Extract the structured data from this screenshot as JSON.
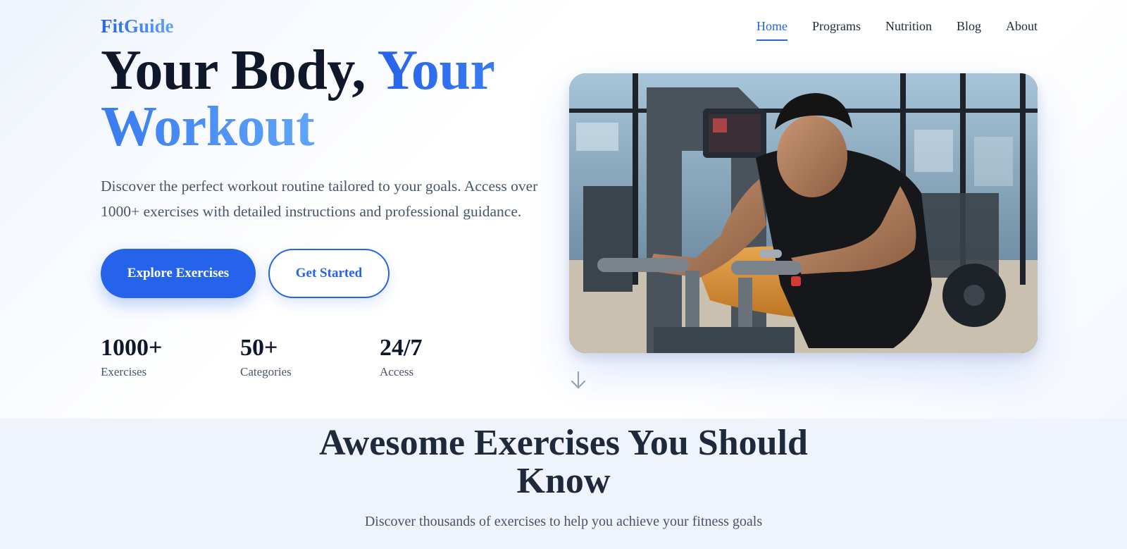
{
  "brand": {
    "name": "FitGuide"
  },
  "nav": {
    "items": [
      {
        "label": "Home",
        "active": true
      },
      {
        "label": "Programs",
        "active": false
      },
      {
        "label": "Nutrition",
        "active": false
      },
      {
        "label": "Blog",
        "active": false
      },
      {
        "label": "About",
        "active": false
      }
    ]
  },
  "hero": {
    "headline_part1": "Your Body, ",
    "headline_part2": "Your Workout",
    "description": "Discover the perfect workout routine tailored to your goals. Access over 1000+ exercises with detailed instructions and professional guidance.",
    "primary_button": "Explore Exercises",
    "secondary_button": "Get Started",
    "stats": [
      {
        "value": "1000+",
        "label": "Exercises"
      },
      {
        "value": "50+",
        "label": "Categories"
      },
      {
        "value": "24/7",
        "label": "Access"
      }
    ],
    "scroll_icon": "arrow-down-icon"
  },
  "exercises_section": {
    "title": "Awesome Exercises You Should Know",
    "subtitle": "Discover thousands of exercises to help you achieve your fitness goals"
  },
  "colors": {
    "accent": "#2563eb",
    "accent_light": "#60a5fa",
    "heading": "#0f172a",
    "body_text": "#475569",
    "section_bg": "#eef3fc"
  }
}
